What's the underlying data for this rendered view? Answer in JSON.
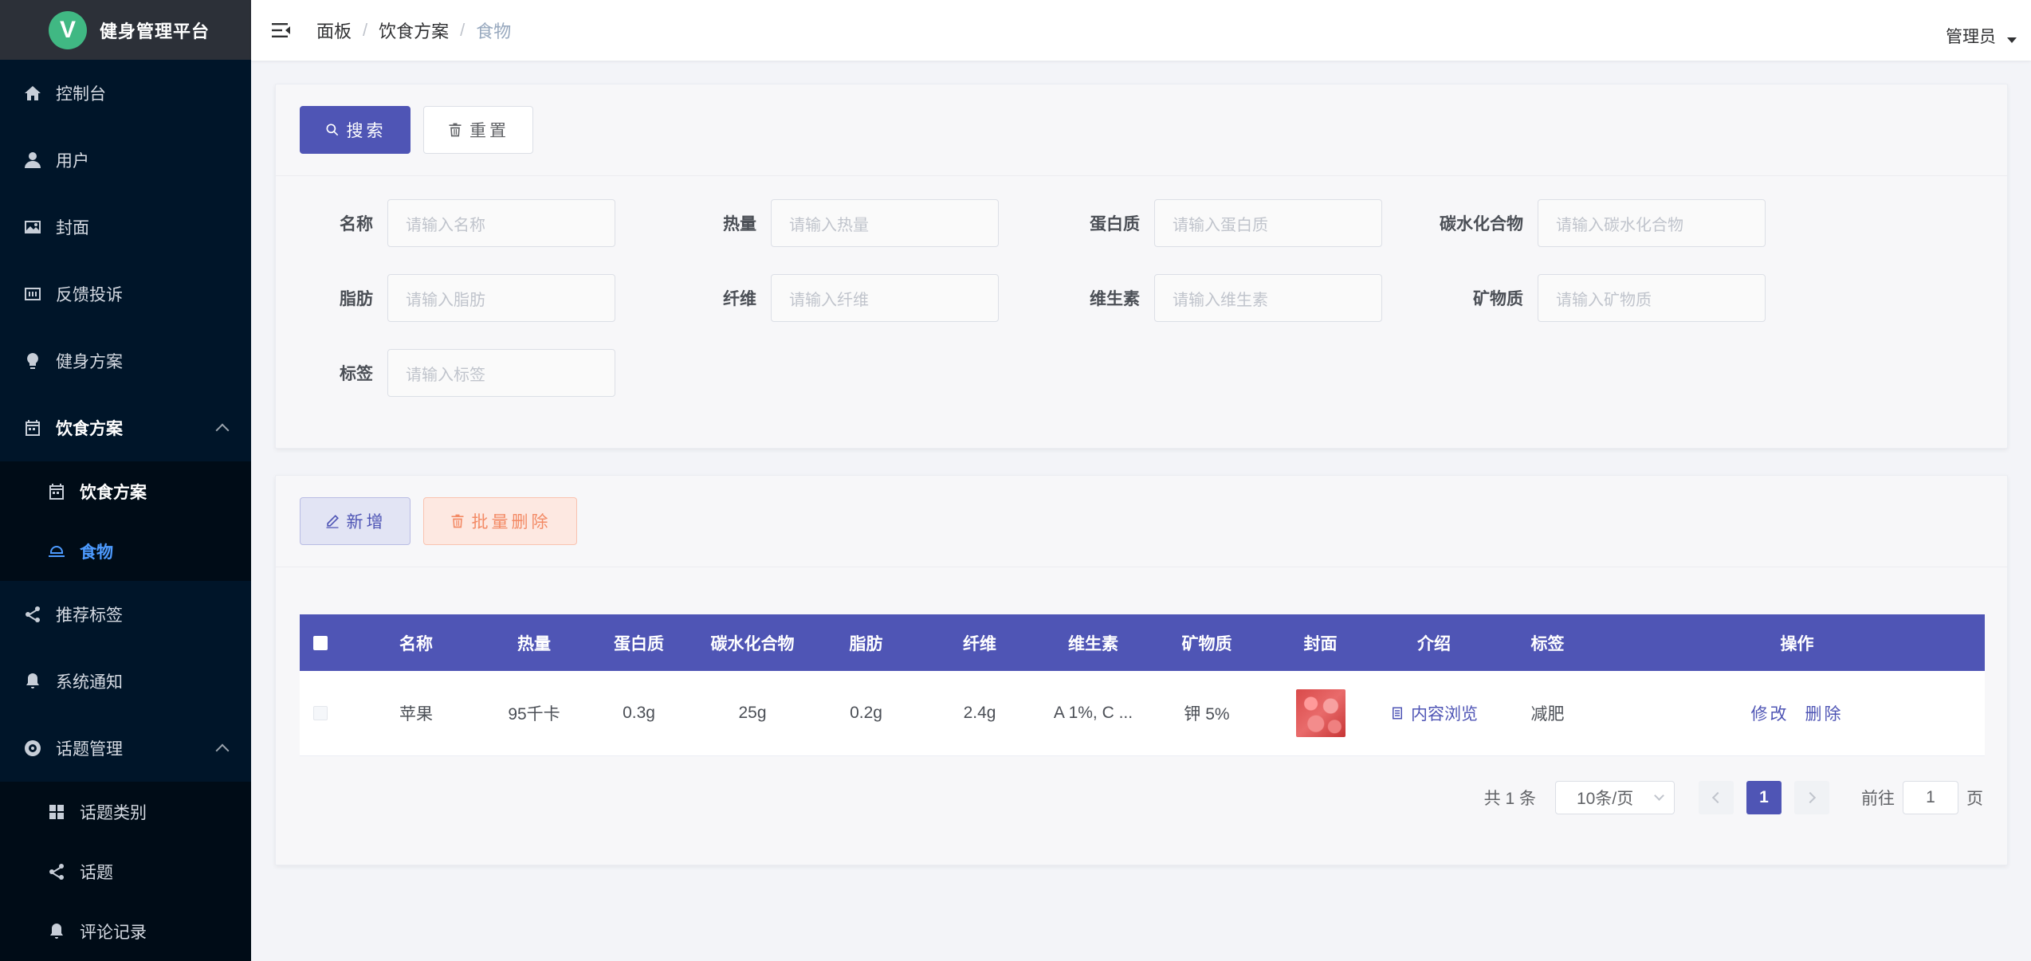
{
  "brand": {
    "logo": "V",
    "title": "健身管理平台"
  },
  "sidebar": {
    "items": [
      {
        "label": "控制台",
        "icon": "home-icon"
      },
      {
        "label": "用户",
        "icon": "user-icon"
      },
      {
        "label": "封面",
        "icon": "picture-icon"
      },
      {
        "label": "反馈投诉",
        "icon": "feedback-icon"
      },
      {
        "label": "健身方案",
        "icon": "bulb-icon"
      },
      {
        "label": "饮食方案",
        "icon": "calendar-icon",
        "expanded": true,
        "children": [
          {
            "label": "饮食方案",
            "icon": "calendar-icon"
          },
          {
            "label": "食物",
            "icon": "food-cover-icon",
            "active": true
          }
        ]
      },
      {
        "label": "推荐标签",
        "icon": "share-icon"
      },
      {
        "label": "系统通知",
        "icon": "bell-icon"
      },
      {
        "label": "话题管理",
        "icon": "lifebuoy-icon",
        "expanded": true,
        "children": [
          {
            "label": "话题类别",
            "icon": "grid-icon"
          },
          {
            "label": "话题",
            "icon": "share-icon"
          },
          {
            "label": "评论记录",
            "icon": "bell-icon"
          }
        ]
      }
    ]
  },
  "header": {
    "breadcrumb": [
      "面板",
      "饮食方案",
      "食物"
    ],
    "user": "管理员"
  },
  "search": {
    "search_label": "搜索",
    "reset_label": "重置",
    "fields": [
      {
        "label": "名称",
        "placeholder": "请输入名称"
      },
      {
        "label": "热量",
        "placeholder": "请输入热量"
      },
      {
        "label": "蛋白质",
        "placeholder": "请输入蛋白质"
      },
      {
        "label": "碳水化合物",
        "placeholder": "请输入碳水化合物"
      },
      {
        "label": "脂肪",
        "placeholder": "请输入脂肪"
      },
      {
        "label": "纤维",
        "placeholder": "请输入纤维"
      },
      {
        "label": "维生素",
        "placeholder": "请输入维生素"
      },
      {
        "label": "矿物质",
        "placeholder": "请输入矿物质"
      },
      {
        "label": "标签",
        "placeholder": "请输入标签"
      }
    ]
  },
  "toolbar": {
    "add_label": "新增",
    "batch_delete_label": "批量删除"
  },
  "table": {
    "columns": [
      "名称",
      "热量",
      "蛋白质",
      "碳水化合物",
      "脂肪",
      "纤维",
      "维生素",
      "矿物质",
      "封面",
      "介绍",
      "标签",
      "操作"
    ],
    "rows": [
      {
        "name": "苹果",
        "calories": "95千卡",
        "protein": "0.3g",
        "carbs": "25g",
        "fat": "0.2g",
        "fiber": "2.4g",
        "vitamin": "A 1%, C ...",
        "mineral": "钾 5%",
        "intro": "内容浏览",
        "tag": "减肥",
        "edit": "修改",
        "delete": "删除"
      }
    ]
  },
  "pager": {
    "total": "共 1 条",
    "page_size": "10条/页",
    "current": "1",
    "goto_prefix": "前往",
    "goto_value": "1",
    "goto_suffix": "页"
  },
  "colors": {
    "primary": "#4f55b5",
    "sidebar": "#001529",
    "active_menu": "#4d9bff",
    "danger": "#f38a65"
  }
}
